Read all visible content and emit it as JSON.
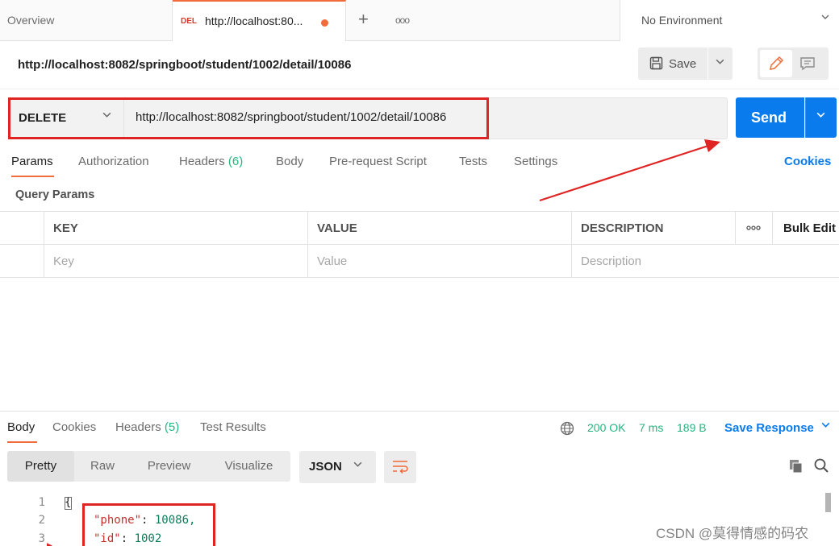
{
  "tabbar": {
    "overview_label": "Overview",
    "active_tab": {
      "method": "DEL",
      "title": "http://localhost:80...",
      "unsaved": true
    },
    "environment": "No Environment"
  },
  "request": {
    "title": "http://localhost:8082/springboot/student/1002/detail/10086",
    "save_label": "Save",
    "method": "DELETE",
    "url": "http://localhost:8082/springboot/student/1002/detail/10086",
    "send_label": "Send"
  },
  "request_tabs": [
    {
      "label": "Params",
      "count": ""
    },
    {
      "label": "Authorization",
      "count": ""
    },
    {
      "label": "Headers",
      "count": "(6)"
    },
    {
      "label": "Body",
      "count": ""
    },
    {
      "label": "Pre-request Script",
      "count": ""
    },
    {
      "label": "Tests",
      "count": ""
    },
    {
      "label": "Settings",
      "count": ""
    }
  ],
  "cookies_label": "Cookies",
  "query_params": {
    "title": "Query Params",
    "columns": [
      "KEY",
      "VALUE",
      "DESCRIPTION"
    ],
    "bulk_edit": "Bulk Edit",
    "placeholders": [
      "Key",
      "Value",
      "Description"
    ]
  },
  "response": {
    "tabs": [
      {
        "label": "Body",
        "count": ""
      },
      {
        "label": "Cookies",
        "count": ""
      },
      {
        "label": "Headers",
        "count": "(5)"
      },
      {
        "label": "Test Results",
        "count": ""
      }
    ],
    "status": "200 OK",
    "time": "7 ms",
    "size": "189 B",
    "save_response": "Save Response",
    "views": [
      "Pretty",
      "Raw",
      "Preview",
      "Visualize"
    ],
    "format": "JSON",
    "code_lines": [
      {
        "num": "1",
        "text": "{"
      },
      {
        "num": "2",
        "key": "\"phone\"",
        "value": "10086,"
      },
      {
        "num": "3",
        "key": "\"id\"",
        "value": "1002"
      }
    ]
  },
  "watermark": "CSDN @莫得情感的码农",
  "colors": {
    "accent": "#f26b3a",
    "primary": "#097bed",
    "success": "#26b47f",
    "highlight": "#e02424"
  }
}
